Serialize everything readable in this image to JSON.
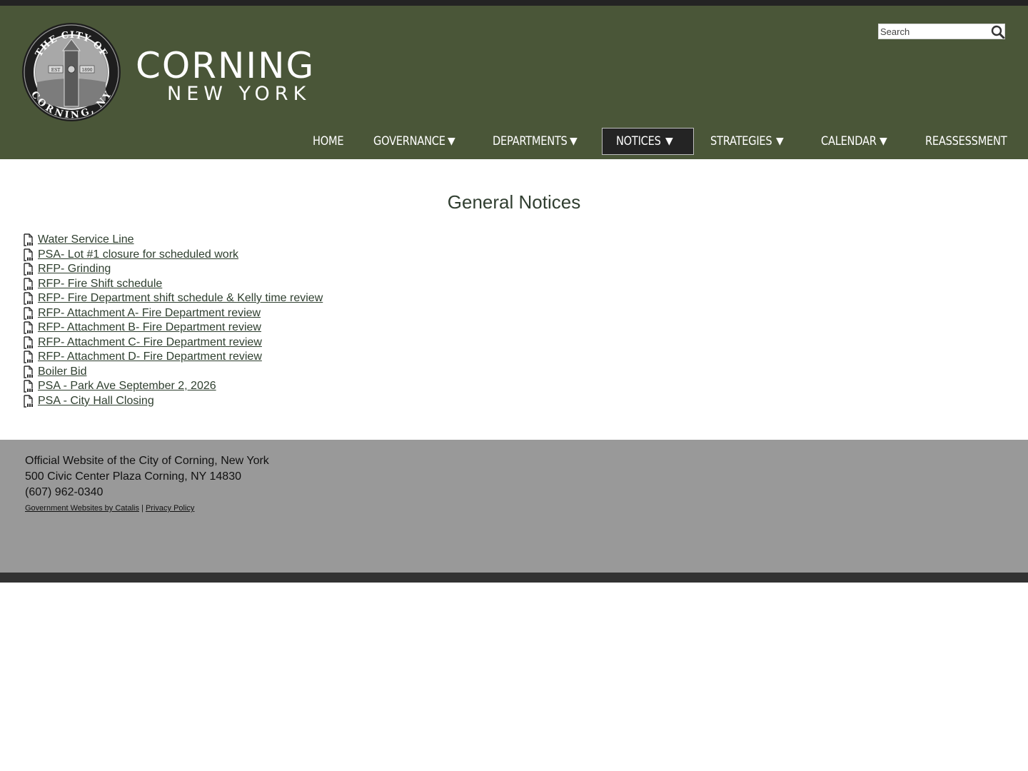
{
  "header": {
    "seal": {
      "top_text": "THE CITY OF",
      "bottom_text": "CORNING, NY",
      "est": "EST",
      "year": "1890"
    },
    "wordmark_main": "CORNING",
    "wordmark_sub": "NEW YORK",
    "search": {
      "placeholder": "Search"
    }
  },
  "nav": {
    "items": [
      {
        "label": "HOME",
        "has_dropdown": false
      },
      {
        "label": "GOVERNANCE",
        "has_dropdown": true
      },
      {
        "label": "DEPARTMENTS",
        "has_dropdown": true
      },
      {
        "label": "NOTICES",
        "has_dropdown": true,
        "active": true
      },
      {
        "label": "STRATEGIES",
        "has_dropdown": true
      },
      {
        "label": "CALENDAR",
        "has_dropdown": true
      },
      {
        "label": "REASSESSMENT",
        "has_dropdown": false
      }
    ],
    "arrow": "▼"
  },
  "main": {
    "title": "General Notices",
    "notices": [
      "Water Service Line",
      "PSA- Lot #1 closure for scheduled work",
      "RFP- Grinding",
      "RFP- Fire Shift schedule",
      "RFP- Fire Department shift schedule & Kelly time review",
      "RFP- Attachment A- Fire Department review",
      "RFP- Attachment B- Fire Department review",
      "RFP- Attachment C- Fire Department review",
      "RFP- Attachment D- Fire Department review",
      "Boiler Bid",
      "PSA - Park Ave September 2, 2026",
      "PSA - City Hall Closing"
    ],
    "file_icon": "pdf-file-icon"
  },
  "footer": {
    "line1": "Official Website of the City of Corning, New York",
    "line2": "500 Civic Center Plaza Corning, NY 14830",
    "line3": "(607) 962-0340",
    "link_catalis": "Government Websites by Catalis",
    "separator": "|",
    "link_privacy": "Privacy Policy"
  },
  "colors": {
    "header_bg": "#4a5638",
    "active_nav_bg": "#242424",
    "footer_bg": "#999999",
    "link": "#2f3f2f"
  }
}
